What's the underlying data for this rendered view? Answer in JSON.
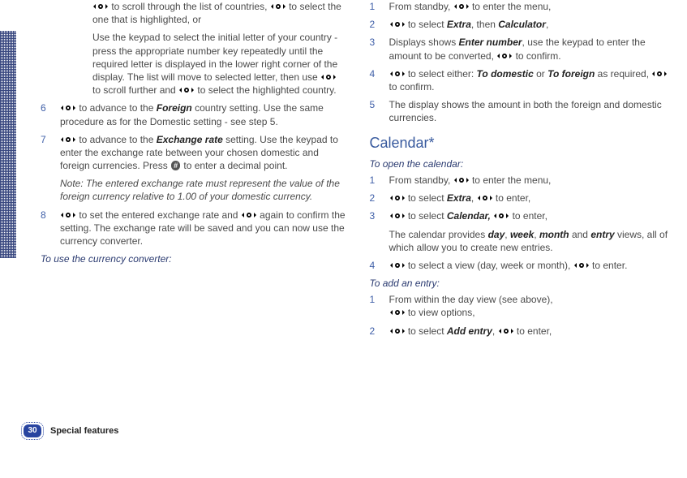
{
  "left": {
    "pre": {
      "p1a": " to scroll through the list of countries, ",
      "p1b": " to select the one that is highlighted, or",
      "p2a": "Use the keypad to select the initial letter of your country - press the appropriate number key repeatedly until the required letter is displayed in the lower right corner of the display. The list will move to selected letter, then use ",
      "p2b": " to scroll further and ",
      "p2c": " to select the highlighted country."
    },
    "step6": {
      "num": "6",
      "a": " to advance to the ",
      "b": "Foreign",
      "c": " country setting. Use the same procedure as for the Domestic setting - see step 5."
    },
    "step7": {
      "num": "7",
      "a": " to advance to the ",
      "b": "Exchange rate",
      "c": " setting. Use the keypad to enter the exchange rate between your chosen domestic and foreign currencies. Press ",
      "key": "#",
      "d": " to enter a decimal point."
    },
    "note": "Note: The entered exchange rate must represent the value of the foreign currency relative to 1.00 of your domestic currency.",
    "step8": {
      "num": "8",
      "a": " to set the entered exchange rate and ",
      "b": " again to confirm the setting. The exchange rate will be saved and you can now use the currency converter."
    },
    "subhead": "To use the currency converter:"
  },
  "right": {
    "conv": {
      "s1": {
        "num": "1",
        "a": "From standby, ",
        "b": " to enter the menu,"
      },
      "s2": {
        "num": "2",
        "a": " to select ",
        "b": "Extra",
        "c": ", then ",
        "d": "Calculator",
        "e": ","
      },
      "s3": {
        "num": "3",
        "a": "Displays shows ",
        "b": "Enter number",
        "c": ", use the keypad to enter the amount to be converted, ",
        "d": " to confirm."
      },
      "s4": {
        "num": "4",
        "a": " to select either: ",
        "b": "To domestic",
        "c": " or ",
        "d": "To foreign",
        "e": " as required, ",
        "f": " to confirm."
      },
      "s5": {
        "num": "5",
        "a": "The display shows the amount in both the foreign and domestic currencies."
      }
    },
    "section": "Calendar*",
    "openHead": "To open the calendar:",
    "open": {
      "s1": {
        "num": "1",
        "a": "From standby, ",
        "b": " to enter the menu,"
      },
      "s2": {
        "num": "2",
        "a": " to select ",
        "b": "Extra",
        "c": ", ",
        "d": " to enter,"
      },
      "s3": {
        "num": "3",
        "a": " to select ",
        "b": "Calendar,",
        "c": " ",
        "d": " to enter,"
      },
      "info1a": "The calendar provides ",
      "info_day": "day",
      "info_c1": ", ",
      "info_week": "week",
      "info_c2": ", ",
      "info_month": "month",
      "info_and": " and ",
      "info_entry": "entry",
      "info2": " views, all of which allow you to create new entries.",
      "s4": {
        "num": "4",
        "a": " to select a view (day, week or month), ",
        "b": " to enter."
      }
    },
    "addHead": "To add an entry:",
    "add": {
      "s1": {
        "num": "1",
        "a": "From within the day view (see above),",
        "b": " to view options,"
      },
      "s2": {
        "num": "2",
        "a": " to select ",
        "b": "Add entry",
        "c": ", ",
        "d": " to enter,"
      }
    }
  },
  "footer": {
    "page": "30",
    "title": "Special features"
  }
}
